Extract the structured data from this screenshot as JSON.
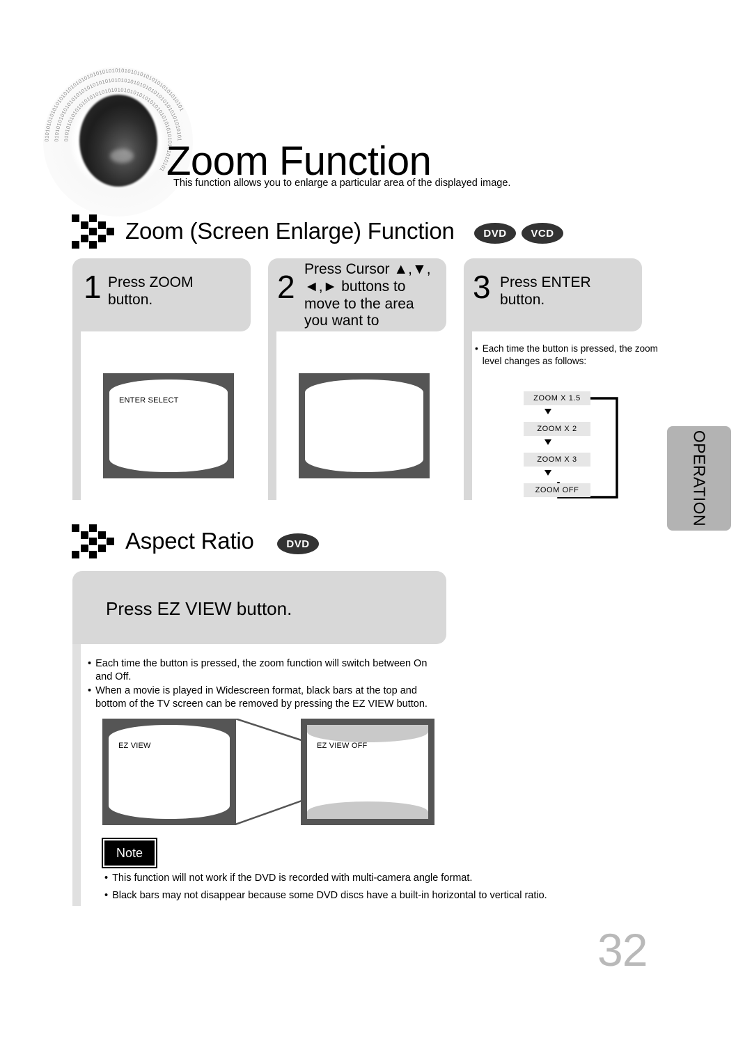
{
  "header": {
    "title": "Zoom Function",
    "intro": "This function allows you to enlarge a particular area of the displayed image.",
    "disc_ring_text": "010101010101010101010101010101010101010101010101010101010101"
  },
  "section_zoom": {
    "heading": "Zoom (Screen Enlarge) Function",
    "badges": [
      "DVD",
      "VCD"
    ],
    "steps": [
      {
        "number": "1",
        "text": "Press ZOOM\nbutton.",
        "tv_label": "ENTER SELECT"
      },
      {
        "number": "2",
        "text": "Press Cursor ▲,▼,\n◄,► buttons to\nmove to the area\nyou want to",
        "tv_label": ""
      },
      {
        "number": "3",
        "text": "Press ENTER\nbutton.",
        "tv_label": ""
      }
    ],
    "step3_note": "Each time the button is pressed, the zoom level changes as follows:",
    "flow": [
      "ZOOM  X 1.5",
      "ZOOM  X 2",
      "ZOOM  X 3",
      "ZOOM  OFF"
    ]
  },
  "section_aspect": {
    "heading": "Aspect Ratio",
    "badges": [
      "DVD"
    ],
    "instruction": "Press EZ VIEW button.",
    "bullets": [
      "Each time the button is pressed, the zoom function will switch between On and Off.",
      "When a movie is played in Widescreen format, black bars at the top and bottom of the TV screen can be removed by pressing the EZ VIEW button."
    ],
    "tv_left_label": "EZ VIEW",
    "tv_right_label": "EZ VIEW OFF"
  },
  "note": {
    "label": "Note",
    "bullets": [
      "This function will not work if the DVD is recorded with multi-camera angle format.",
      "Black bars may not disappear because some DVD discs have a built-in horizontal to vertical ratio."
    ]
  },
  "footer": {
    "side_tab": "OPERATION",
    "page_number": "32"
  },
  "colors": {
    "panel_gray": "#d8d8d8",
    "rail_gray": "#e0e0e0",
    "badge_dark": "#333333",
    "tv_bezel": "#555555",
    "tab_gray": "#b3b3b3",
    "page_number_gray": "#b9b9b9",
    "flow_box_gray": "#e6e6e6"
  }
}
